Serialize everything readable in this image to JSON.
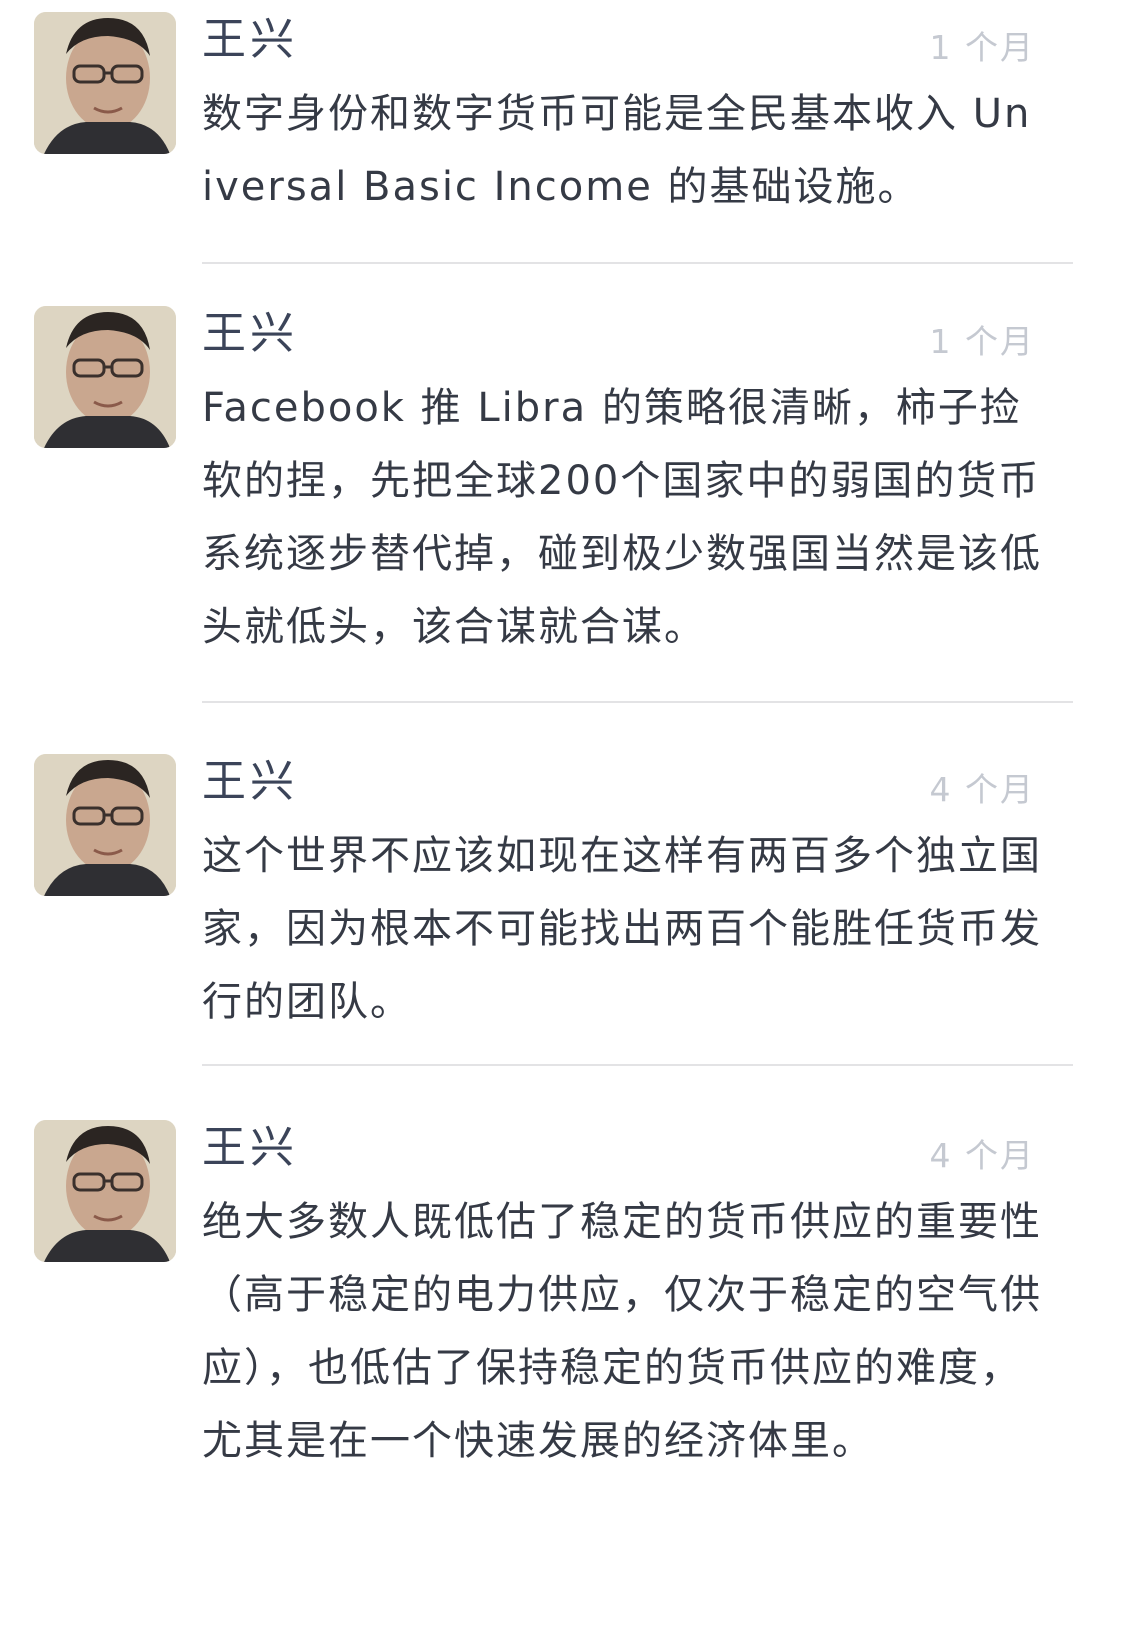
{
  "posts": [
    {
      "author": "王兴",
      "time": "1 个月",
      "content": "数字身份和数字货币可能是全民基本收入 Universal Basic Income 的基础设施。"
    },
    {
      "author": "王兴",
      "time": "1 个月",
      "content": "Facebook 推 Libra 的策略很清晰，柿子捡软的捏，先把全球200个国家中的弱国的货币系统逐步替代掉，碰到极少数强国当然是该低头就低头，该合谋就合谋。"
    },
    {
      "author": "王兴",
      "time": "4 个月",
      "content": "这个世界不应该如现在这样有两百多个独立国家，因为根本不可能找出两百个能胜任货币发行的团队。"
    },
    {
      "author": "王兴",
      "time": "4 个月",
      "content": "绝大多数人既低估了稳定的货币供应的重要性（高于稳定的电力供应，仅次于稳定的空气供应），也低估了保持稳定的货币供应的难度，尤其是在一个快速发展的经济体里。"
    }
  ],
  "colors": {
    "author": "#3b4459",
    "time": "#c5c9d1",
    "content": "#353a45",
    "divider": "#e3e3e5"
  },
  "icons": {
    "avatar": "user-avatar-photo"
  }
}
